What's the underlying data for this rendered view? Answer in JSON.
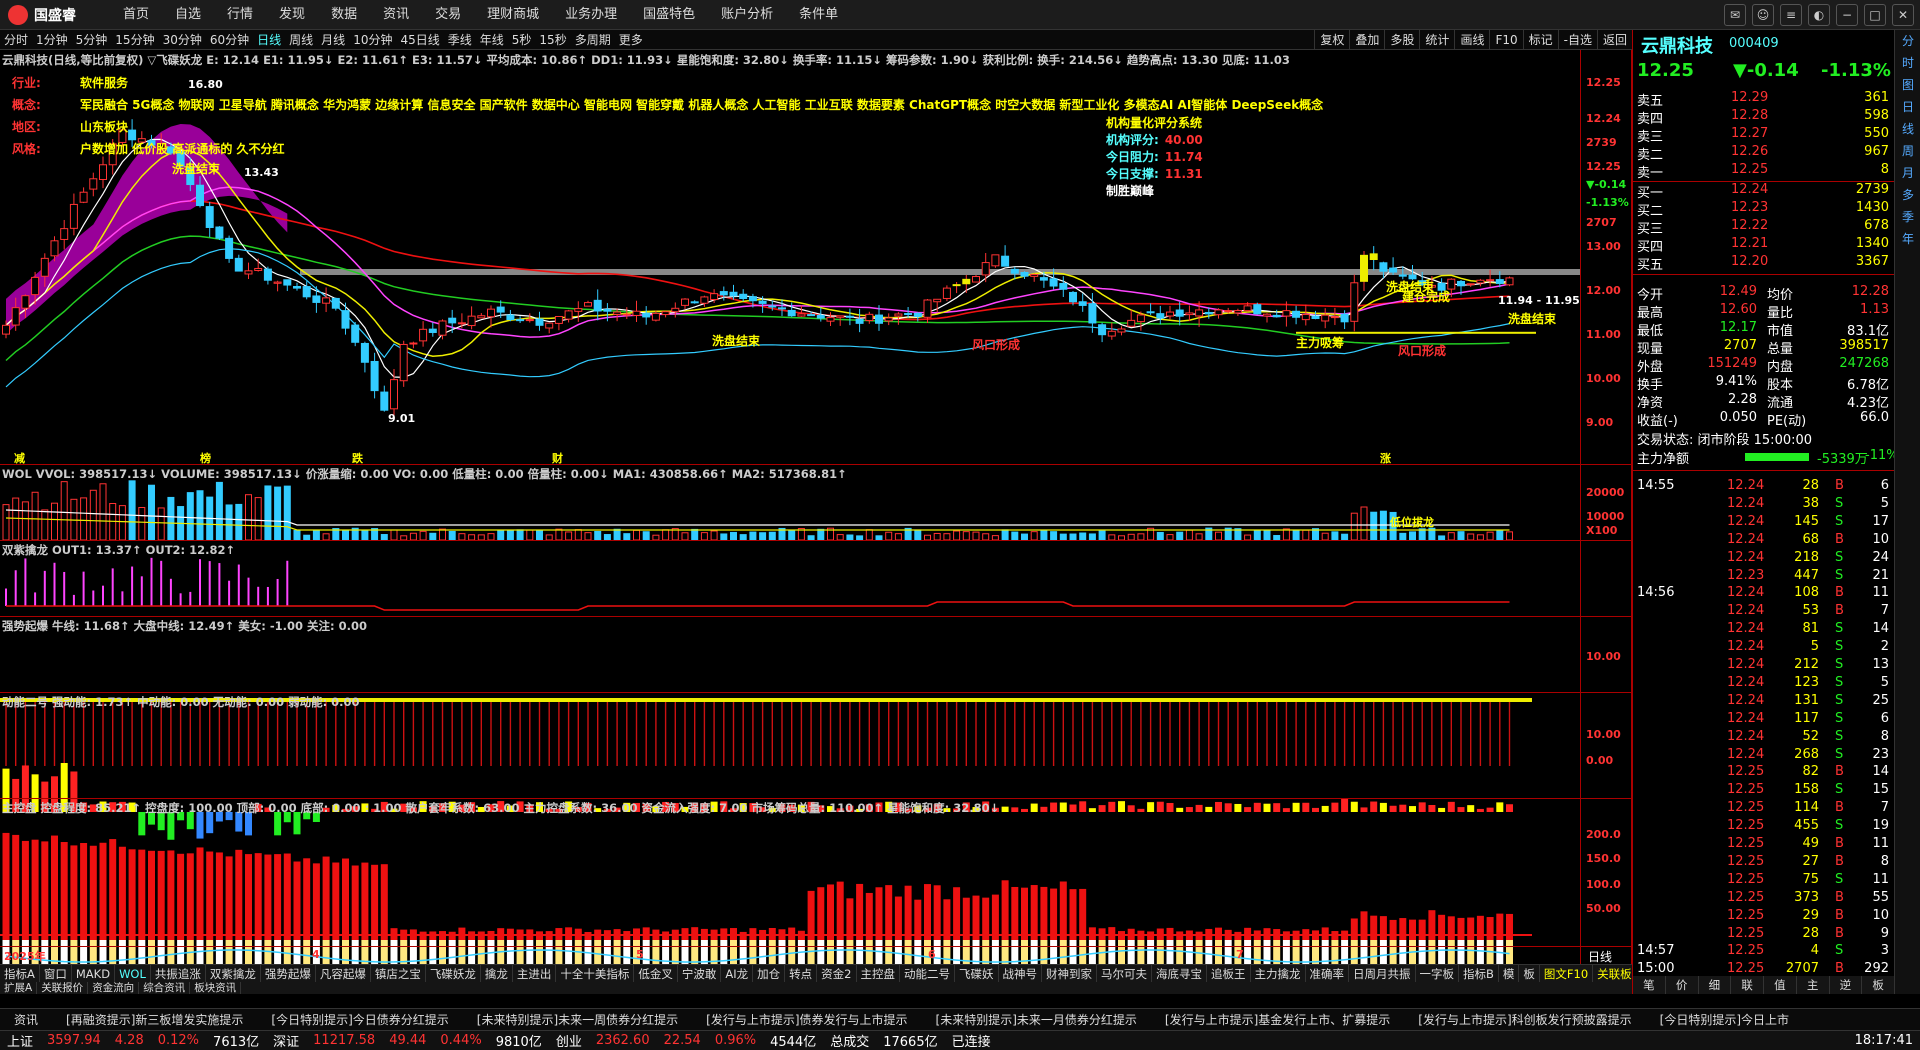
{
  "menubar": {
    "logo": "国盛睿",
    "items": [
      "首页",
      "自选",
      "行情",
      "发现",
      "数据",
      "资讯",
      "交易",
      "理财商城",
      "业务办理",
      "国盛特色",
      "账户分析",
      "条件单"
    ]
  },
  "periods": {
    "items": [
      "分时",
      "1分钟",
      "5分钟",
      "15分钟",
      "30分钟",
      "60分钟",
      "日线",
      "周线",
      "月线",
      "10分钟",
      "45日线",
      "季线",
      "年线",
      "5秒",
      "15秒",
      "多周期",
      "更多"
    ],
    "active": "日线"
  },
  "toolbar": [
    "复权",
    "叠加",
    "多股",
    "统计",
    "画线",
    "F10",
    "标记",
    "-自选",
    "返回"
  ],
  "chart": {
    "header": "云鼎科技(日线,等比前复权)  ▽飞碟妖龙 E: 12.14  E1: 11.95↓ E2: 11.61↑ E3: 11.57↓ 平均成本: 10.86↑ DD1: 11.93↓ 星能饱和度: 32.80↓ 换手率: 11.15↓ 筹码参数: 1.90↓ 获利比例:  换手: 214.56↓ 趋势高点: 13.30 见底: 11.03",
    "info_rows": [
      {
        "label": "行业:",
        "value": "软件服务"
      },
      {
        "label": "概念:",
        "value": "军民融合 5G概念 物联网 卫星导航 腾讯概念 华为鸿蒙 边缘计算 信息安全 国产软件 数据中心 智能电网 智能穿戴 机器人概念 人工智能 工业互联 数据要素 ChatGPT概念 时空大数据 新型工业化 多模态AI AI智能体 DeepSeek概念"
      },
      {
        "label": "地区:",
        "value": "山东板块"
      },
      {
        "label": "风格:",
        "value": "户数增加 低价股 高派通标的 久不分红"
      }
    ],
    "quant": {
      "title": "机构量化评分系统",
      "rows": [
        {
          "k": "机构评分:",
          "v": "40.00"
        },
        {
          "k": "今日阻力:",
          "v": "11.74"
        },
        {
          "k": "今日支撑:",
          "v": "11.31"
        }
      ],
      "footer": "制胜巅峰"
    },
    "price_labels": [
      "16.80",
      "13.43",
      "9.01",
      "11.94 - 11.95"
    ],
    "annotations": [
      "洗盘结束",
      "洗盘结束",
      "风口形成",
      "主力吸筹",
      "风口形成",
      "洗盘结束",
      "建仓完成",
      "洗盘结束"
    ],
    "y_ticks": [
      "12.25",
      "12.24",
      "2739",
      "12.25",
      "▼-0.14",
      "-1.13%",
      "2707",
      "13.00",
      "12.00",
      "11.00",
      "10.00",
      "9.00"
    ],
    "bottom_marks": [
      "减",
      "榜",
      "跌",
      "财",
      "涨"
    ]
  },
  "wol": {
    "header": "WOL  VVOL: 398517.13↓ VOLUME: 398517.13↓ 价涨量缩: 0.00 VO: 0.00 低量柱: 0.00 倍量柱: 0.00↓ MA1: 430858.66↑ MA2: 517368.81↑",
    "ticks": [
      "20000",
      "10000",
      "X100"
    ],
    "label": "低位拔龙"
  },
  "shuangzi": {
    "header": "双紫擒龙  OUT1: 13.37↑ OUT2: 12.82↑"
  },
  "qiangshi": {
    "header": "强势起爆  牛线: 11.68↑ 大盘中线: 12.49↑ 美女: -1.00 关注: 0.00",
    "ticks": [
      "10.00"
    ]
  },
  "dongneng": {
    "header": "动能二号  强动能: 1.73↑ 中动能: 0.00 无动能: 0.00 弱动能: 0.00",
    "ticks": [
      "10.00",
      "0.00"
    ]
  },
  "zhukong": {
    "header": "主控盘  控盘程度: 85.21↑ 控盘度: 100.00 顶部: 0.00 底部: 0.00 : 1.00 散户套牢系数: 63.00 主力控盘系数: 36.00 资金流入强度: 7.00 市场筹码总量: 110.00↑ 星能饱和度: 32.80↓",
    "ticks": [
      "200.0",
      "150.0",
      "100.0",
      "50.00"
    ]
  },
  "xaxis": [
    "2025年",
    "4",
    "5",
    "6",
    "7"
  ],
  "right": {
    "name": "云鼎科技",
    "code": "000409",
    "price": "12.25",
    "change": "▼-0.14",
    "pct": "-1.13%",
    "asks": [
      {
        "l": "卖五",
        "p": "12.29",
        "v": "361"
      },
      {
        "l": "卖四",
        "p": "12.28",
        "v": "598"
      },
      {
        "l": "卖三",
        "p": "12.27",
        "v": "550"
      },
      {
        "l": "卖二",
        "p": "12.26",
        "v": "967"
      },
      {
        "l": "卖一",
        "p": "12.25",
        "v": "8"
      }
    ],
    "bids": [
      {
        "l": "买一",
        "p": "12.24",
        "v": "2739"
      },
      {
        "l": "买二",
        "p": "12.23",
        "v": "1430"
      },
      {
        "l": "买三",
        "p": "12.22",
        "v": "678"
      },
      {
        "l": "买四",
        "p": "12.21",
        "v": "1340"
      },
      {
        "l": "买五",
        "p": "12.20",
        "v": "3367"
      }
    ],
    "stats": [
      {
        "a": "今开",
        "av": "12.49",
        "b": "均价",
        "bv": "12.28"
      },
      {
        "a": "最高",
        "av": "12.60",
        "b": "量比",
        "bv": "1.13"
      },
      {
        "a": "最低",
        "av": "12.17",
        "b": "市值",
        "bv": "83.1亿"
      },
      {
        "a": "现量",
        "av": "2707",
        "b": "总量",
        "bv": "398517"
      },
      {
        "a": "外盘",
        "av": "151249",
        "b": "内盘",
        "bv": "247268"
      },
      {
        "a": "换手",
        "av": "9.41%",
        "b": "股本",
        "bv": "6.78亿"
      },
      {
        "a": "净资",
        "av": "2.28",
        "b": "流通",
        "bv": "4.23亿"
      },
      {
        "a": "收益(-)",
        "av": "0.050",
        "b": "PE(动)",
        "bv": "66.0"
      }
    ],
    "trade_state": "交易状态: 闭市阶段 15:00:00",
    "net_inflow_label": "主力净额",
    "net_inflow": "-5339万",
    "net_pct": "-11%",
    "ticks": [
      {
        "t": "14:55",
        "p": "12.24",
        "v": "28",
        "s": "B",
        "n": "6"
      },
      {
        "t": "",
        "p": "12.24",
        "v": "38",
        "s": "S",
        "n": "5"
      },
      {
        "t": "",
        "p": "12.24",
        "v": "145",
        "s": "S",
        "n": "17"
      },
      {
        "t": "",
        "p": "12.24",
        "v": "68",
        "s": "B",
        "n": "10"
      },
      {
        "t": "",
        "p": "12.24",
        "v": "218",
        "s": "S",
        "n": "24"
      },
      {
        "t": "",
        "p": "12.23",
        "v": "447",
        "s": "S",
        "n": "21"
      },
      {
        "t": "14:56",
        "p": "12.24",
        "v": "108",
        "s": "B",
        "n": "11"
      },
      {
        "t": "",
        "p": "12.24",
        "v": "53",
        "s": "B",
        "n": "7"
      },
      {
        "t": "",
        "p": "12.24",
        "v": "81",
        "s": "S",
        "n": "14"
      },
      {
        "t": "",
        "p": "12.24",
        "v": "5",
        "s": "S",
        "n": "2"
      },
      {
        "t": "",
        "p": "12.24",
        "v": "212",
        "s": "S",
        "n": "13"
      },
      {
        "t": "",
        "p": "12.24",
        "v": "123",
        "s": "S",
        "n": "5"
      },
      {
        "t": "",
        "p": "12.24",
        "v": "131",
        "s": "S",
        "n": "25"
      },
      {
        "t": "",
        "p": "12.24",
        "v": "117",
        "s": "S",
        "n": "6"
      },
      {
        "t": "",
        "p": "12.24",
        "v": "52",
        "s": "S",
        "n": "8"
      },
      {
        "t": "",
        "p": "12.24",
        "v": "268",
        "s": "S",
        "n": "23"
      },
      {
        "t": "",
        "p": "12.25",
        "v": "82",
        "s": "B",
        "n": "14"
      },
      {
        "t": "",
        "p": "12.25",
        "v": "158",
        "s": "S",
        "n": "15"
      },
      {
        "t": "",
        "p": "12.25",
        "v": "114",
        "s": "B",
        "n": "7"
      },
      {
        "t": "",
        "p": "12.25",
        "v": "455",
        "s": "S",
        "n": "19"
      },
      {
        "t": "",
        "p": "12.25",
        "v": "49",
        "s": "B",
        "n": "11"
      },
      {
        "t": "",
        "p": "12.25",
        "v": "27",
        "s": "B",
        "n": "8"
      },
      {
        "t": "",
        "p": "12.25",
        "v": "75",
        "s": "S",
        "n": "11"
      },
      {
        "t": "",
        "p": "12.25",
        "v": "373",
        "s": "B",
        "n": "55"
      },
      {
        "t": "",
        "p": "12.25",
        "v": "29",
        "s": "B",
        "n": "10"
      },
      {
        "t": "",
        "p": "12.25",
        "v": "28",
        "s": "B",
        "n": "9"
      },
      {
        "t": "14:57",
        "p": "12.25",
        "v": "4",
        "s": "S",
        "n": "3"
      },
      {
        "t": "15:00",
        "p": "12.25",
        "v": "2707",
        "s": "B",
        "n": "292"
      }
    ],
    "bottom_tabs": [
      "笔",
      "价",
      "细",
      "联",
      "值",
      "主",
      "逆",
      "板"
    ],
    "chart_tabs": [
      "图文F10",
      "关联板块"
    ]
  },
  "sidebar": [
    "分",
    "时",
    "图",
    "日",
    "线",
    "周",
    "月",
    "多",
    "季",
    "年"
  ],
  "bottom_tabs": [
    "指标A",
    "窗口",
    "MAKD",
    "WOL",
    "共振追涨",
    "双紫擒龙",
    "强势起爆",
    "凡容起爆",
    "镇店之宝",
    "飞碟妖龙",
    "擒龙",
    "主进出",
    "十全十美指标",
    "低金叉",
    "宁波敢",
    "AI龙",
    "加仓",
    "转点",
    "资金2",
    "主控盘",
    "动能二号",
    "飞碟妖",
    "战神号",
    "财神到家",
    "马尔可夫",
    "海底寻宝",
    "追板王",
    "主力擒龙",
    "准确率",
    "日周月共振",
    "一字板",
    "指标B",
    "模",
    "板"
  ],
  "bottom_tabs2": [
    "扩展A",
    "关联报价",
    "资金流向",
    "综合资讯",
    "板块资讯"
  ],
  "news": [
    "资讯",
    "[再融资提示]新三板增发实施提示",
    "[今日特别提示]今日债券分红提示",
    "[未来特别提示]未来一周债券分红提示",
    "[发行与上市提示]债券发行与上市提示",
    "[未来特别提示]未来一月债券分红提示",
    "[发行与上市提示]基金发行上市、扩募提示",
    "[发行与上市提示]科创板发行预披露提示",
    "[今日特别提示]今日上市"
  ],
  "status": {
    "sh_label": "上证",
    "sh": "3597.94",
    "sh_chg": "4.28",
    "sh_pct": "0.12%",
    "sh_amt": "7613亿",
    "sz_label": "深证",
    "sz": "11217.58",
    "sz_chg": "49.44",
    "sz_pct": "0.44%",
    "sz_amt": "9810亿",
    "cy_label": "创业",
    "cy": "2362.60",
    "cy_chg": "22.54",
    "cy_pct": "0.96%",
    "cy_amt": "4544亿",
    "total_label": "总成交",
    "total": "17665亿",
    "conn": "已连接",
    "time": "18:17:41"
  }
}
